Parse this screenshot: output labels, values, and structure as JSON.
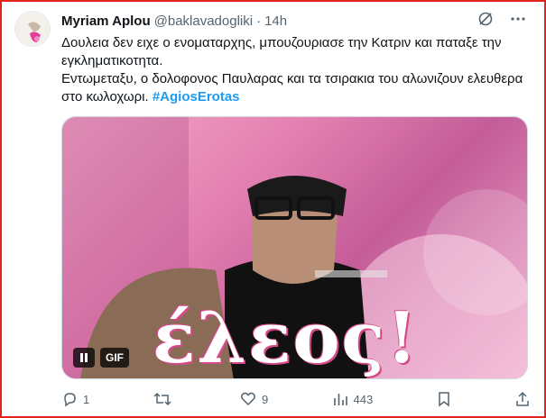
{
  "author": {
    "name": "Myriam Aplou",
    "handle": "@baklavadogliki",
    "separator": "·",
    "time": "14h"
  },
  "tweet": {
    "line1": "Δουλεια δεν ειχε ο ενοματαρχης, μπουζουριασε την Κατριν και παταξε την εγκληματικοτητα.",
    "line2": "Εντωμεταξυ, ο δολοφονος Παυλαρας και τα τσιρακια του αλωνιζουν ελευθερα στο κωλοχωρι.",
    "hashtag": "#AgiosErotas"
  },
  "media": {
    "overlay_text": "έλεος!",
    "gif_badge": "GIF"
  },
  "actions": {
    "replies": "1",
    "reposts": "",
    "likes": "9",
    "views": "443"
  },
  "colors": {
    "accent": "#1d9bf0",
    "frame": "#e0241b",
    "muted": "#536471"
  }
}
